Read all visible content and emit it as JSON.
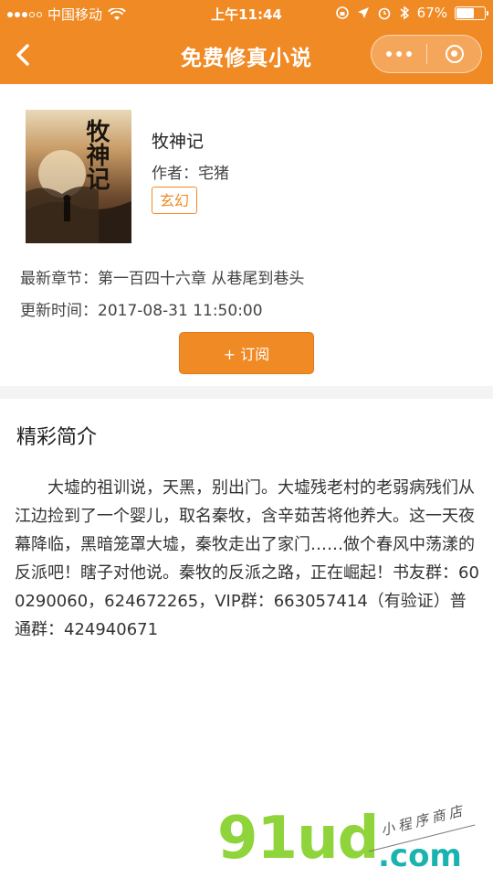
{
  "status_bar": {
    "carrier": "中国移动",
    "time": "上午11:44",
    "battery_percent": "67%",
    "battery_level": 0.67
  },
  "nav": {
    "title": "免费修真小说",
    "back_icon": "chevron-left-icon",
    "more_icon": "more-dots-icon",
    "close_icon": "target-ring-icon"
  },
  "book": {
    "title": "牧神记",
    "cover_text": "牧神记",
    "author_label": "作者：",
    "author": "宅猪",
    "tag": "玄幻",
    "latest_label": "最新章节：",
    "latest_chapter": "第一百四十六章 从巷尾到巷头",
    "updated_label": "更新时间：",
    "updated_time": "2017-08-31 11:50:00",
    "subscribe_label": "+ 订阅"
  },
  "intro": {
    "heading": "精彩简介",
    "text": "大墟的祖训说，天黑，别出门。大墟残老村的老弱病残们从江边捡到了一个婴儿，取名秦牧，含辛茹苦将他养大。这一天夜幕降临，黑暗笼罩大墟，秦牧走出了家门……做个春风中荡漾的反派吧！瞎子对他说。秦牧的反派之路，正在崛起！书友群：600290060，624672265，VIP群：663057414（有验证）普通群：424940671"
  },
  "watermark": {
    "brand": "91ud",
    "domain": ".com",
    "tagline": "小程序商店"
  },
  "colors": {
    "accent": "#f08a24",
    "watermark_green": "#8fd43a",
    "watermark_teal": "#1bb3b0"
  }
}
